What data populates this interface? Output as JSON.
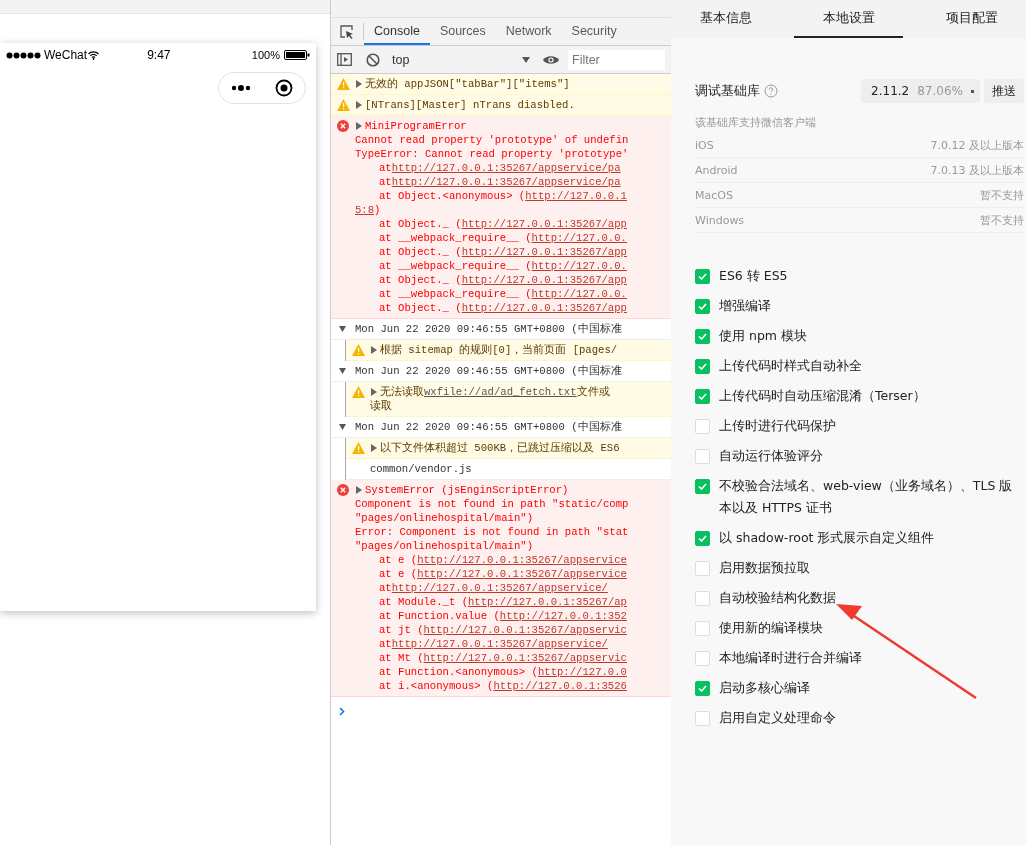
{
  "phone": {
    "carrier": "WeChat",
    "time": "9:47",
    "battery": "100%"
  },
  "devtools": {
    "tabs": [
      {
        "label": "Console",
        "selected": true
      },
      {
        "label": "Sources",
        "selected": false
      },
      {
        "label": "Network",
        "selected": false
      },
      {
        "label": "Security",
        "selected": false
      }
    ],
    "context": "top",
    "filter": {
      "placeholder": "Filter"
    },
    "entries": [
      {
        "kind": "warning",
        "lines": [
          {
            "text": "无效的 appJSON[\"tabBar\"][\"items\"]"
          }
        ]
      },
      {
        "kind": "warning",
        "lines": [
          {
            "text": "[NTrans][Master] nTrans diasbled."
          }
        ]
      },
      {
        "kind": "error",
        "title": "MiniProgramError",
        "lines": [
          {
            "text": "Cannot read property 'prototype' of undefin"
          },
          {
            "text": "TypeError: Cannot read property 'prototype'"
          },
          {
            "indent": true,
            "text": "at ",
            "url": "http://127.0.0.1:35267/appservice/pa"
          },
          {
            "indent": true,
            "text": "at ",
            "url": "http://127.0.0.1:35267/appservice/pa"
          },
          {
            "indent": true,
            "text": "at Object.<anonymous> (",
            "url": "http://127.0.0.1"
          },
          {
            "url": "5:8",
            "after": ")"
          },
          {
            "indent": true,
            "text": "at Object._ (",
            "url": "http://127.0.0.1:35267/app"
          },
          {
            "indent": true,
            "text": "at __webpack_require__ (",
            "url": "http://127.0.0."
          },
          {
            "indent": true,
            "text": "at Object._ (",
            "url": "http://127.0.0.1:35267/app"
          },
          {
            "indent": true,
            "text": "at __webpack_require__ (",
            "url": "http://127.0.0."
          },
          {
            "indent": true,
            "text": "at Object._ (",
            "url": "http://127.0.0.1:35267/app"
          },
          {
            "indent": true,
            "text": "at __webpack_require__ (",
            "url": "http://127.0.0."
          },
          {
            "indent": true,
            "text": "at Object._ (",
            "url": "http://127.0.0.1:35267/app"
          }
        ]
      },
      {
        "kind": "group",
        "header": "Mon Jun 22 2020 09:46:55 GMT+0800 (中国标准",
        "children": [
          {
            "kind": "warning",
            "lines": [
              {
                "text": " 根据 sitemap 的规则[0]，当前页面 [pages/"
              }
            ]
          }
        ]
      },
      {
        "kind": "group",
        "header": "Mon Jun 22 2020 09:46:55 GMT+0800 (中国标准",
        "children": [
          {
            "kind": "warning",
            "lines": [
              {
                "text": "无法读取 ",
                "url": "wxfile://ad/ad_fetch.txt",
                "after": " 文件或"
              },
              {
                "text": "读取"
              }
            ]
          }
        ]
      },
      {
        "kind": "group",
        "header": "Mon Jun 22 2020 09:46:55 GMT+0800 (中国标准",
        "children": [
          {
            "kind": "warning",
            "lines": [
              {
                "text": "以下文件体积超过 500KB，已跳过压缩以及 ES6"
              }
            ]
          },
          {
            "kind": "log",
            "lines": [
              {
                "text": "common/vendor.js"
              }
            ]
          }
        ]
      },
      {
        "kind": "error",
        "title": "SystemError (jsEnginScriptError)",
        "lines": [
          {
            "text": "Component is not found in path \"static/comp"
          },
          {
            "text": "\"pages/onlinehospital/main\")"
          },
          {
            "text": "Error: Component is not found in path \"stat"
          },
          {
            "text": "\"pages/onlinehospital/main\")"
          },
          {
            "indent": true,
            "text": "at e (",
            "url": "http://127.0.0.1:35267/appservice"
          },
          {
            "indent": true,
            "text": "at e (",
            "url": "http://127.0.0.1:35267/appservice"
          },
          {
            "indent": true,
            "text": "at ",
            "url": "http://127.0.0.1:35267/appservice/"
          },
          {
            "indent": true,
            "text": "at Module._t (",
            "url": "http://127.0.0.1:35267/ap"
          },
          {
            "indent": true,
            "text": "at Function.value (",
            "url": "http://127.0.0.1:352"
          },
          {
            "indent": true,
            "text": "at jt (",
            "url": "http://127.0.0.1:35267/appservic"
          },
          {
            "indent": true,
            "text": "at ",
            "url": "http://127.0.0.1:35267/appservice/"
          },
          {
            "indent": true,
            "text": "at Mt (",
            "url": "http://127.0.0.1:35267/appservic"
          },
          {
            "indent": true,
            "text": "at Function.<anonymous> (",
            "url": "http://127.0.0"
          },
          {
            "indent": true,
            "text": "at i.<anonymous> (",
            "url": "http://127.0.0.1:3526"
          }
        ]
      }
    ]
  },
  "settings": {
    "tabs": [
      {
        "label": "基本信息",
        "selected": false
      },
      {
        "label": "本地设置",
        "selected": true
      },
      {
        "label": "项目配置",
        "selected": false
      }
    ],
    "library": {
      "label": "调试基础库",
      "version": "2.11.2",
      "share": "87.06%",
      "push": "推送"
    },
    "support_title": "该基础库支持微信客户端",
    "support": [
      {
        "platform": "iOS",
        "value": "7.0.12 及以上版本"
      },
      {
        "platform": "Android",
        "value": "7.0.13 及以上版本"
      },
      {
        "platform": "MacOS",
        "value": "暂不支持"
      },
      {
        "platform": "Windows",
        "value": "暂不支持"
      }
    ],
    "options": [
      {
        "label": "ES6 转 ES5",
        "checked": true
      },
      {
        "label": "增强编译",
        "checked": true
      },
      {
        "label": "使用 npm 模块",
        "checked": true
      },
      {
        "label": "上传代码时样式自动补全",
        "checked": true
      },
      {
        "label": "上传代码时自动压缩混淆（Terser）",
        "checked": true
      },
      {
        "label": "上传时进行代码保护",
        "checked": false
      },
      {
        "label": "自动运行体验评分",
        "checked": false
      },
      {
        "label": "不校验合法域名、web-view（业务域名）、TLS 版本以及 HTTPS 证书",
        "checked": true
      },
      {
        "label": "以 shadow-root 形式展示自定义组件",
        "checked": true
      },
      {
        "label": "启用数据预拉取",
        "checked": false
      },
      {
        "label": "自动校验结构化数据",
        "checked": false
      },
      {
        "label": "使用新的编译模块",
        "checked": false
      },
      {
        "label": "本地编译时进行合并编译",
        "checked": false
      },
      {
        "label": "启动多核心编译",
        "checked": true
      },
      {
        "label": "启用自定义处理命令",
        "checked": false
      }
    ]
  }
}
